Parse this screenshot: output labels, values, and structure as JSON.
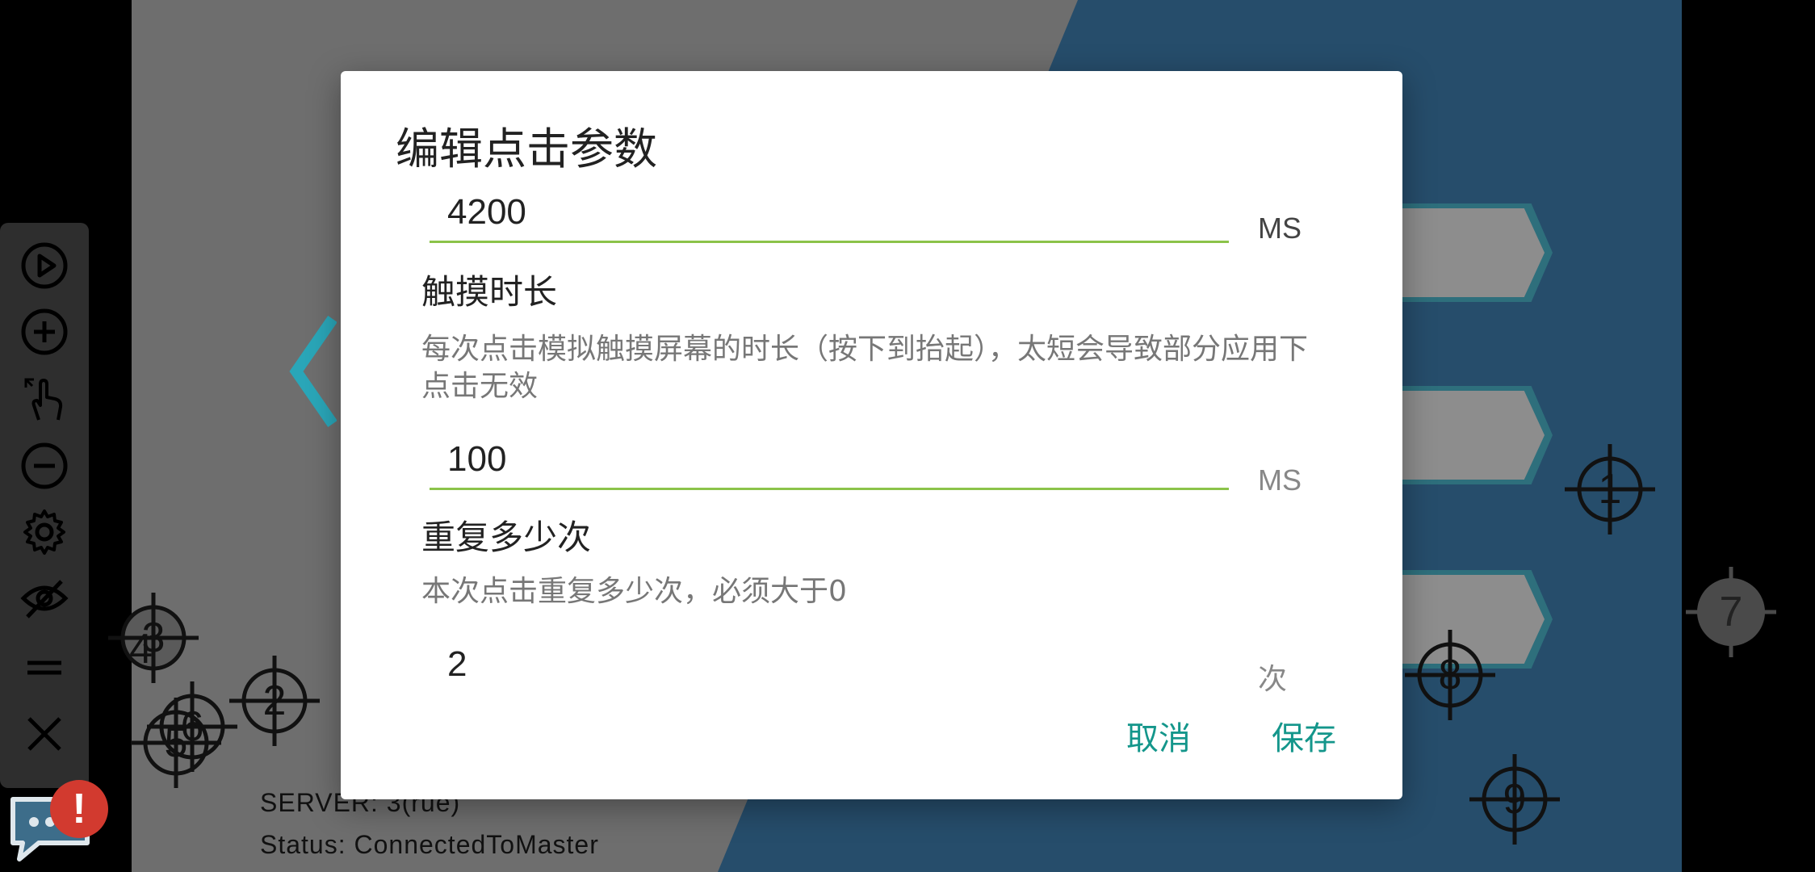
{
  "dialog": {
    "title": "编辑点击参数",
    "delay_value": "4200",
    "delay_unit": "MS",
    "touch_title": "触摸时长",
    "touch_desc": "每次点击模拟触摸屏幕的时长（按下到抬起），太短会导致部分应用下点击无效",
    "touch_value": "100",
    "touch_unit": "MS",
    "repeat_title": "重复多少次",
    "repeat_desc": "本次点击重复多少次，必须大于0",
    "repeat_value": "2",
    "repeat_unit": "次",
    "cancel_label": "取消",
    "save_label": "保存"
  },
  "markers": [
    {
      "label": "1"
    },
    {
      "label": "2"
    },
    {
      "label": "3"
    },
    {
      "label": "4"
    },
    {
      "label": "5"
    },
    {
      "label": "6"
    },
    {
      "label": "7"
    },
    {
      "label": "8"
    },
    {
      "label": "9"
    }
  ],
  "status": {
    "server": "SERVER: 3(rue)",
    "status": "Status: ConnectedToMaster"
  },
  "notification_badge": "!",
  "toolbar": {
    "icons": [
      "play-icon",
      "add-icon",
      "tap-gesture-icon",
      "remove-icon",
      "gear-icon",
      "eye-off-icon",
      "drag-handle-icon",
      "close-icon"
    ]
  },
  "colors": {
    "accent": "#14968b",
    "underline": "#8bc34a",
    "game_blue": "#264d6b",
    "game_gray": "#6e6e6e"
  }
}
